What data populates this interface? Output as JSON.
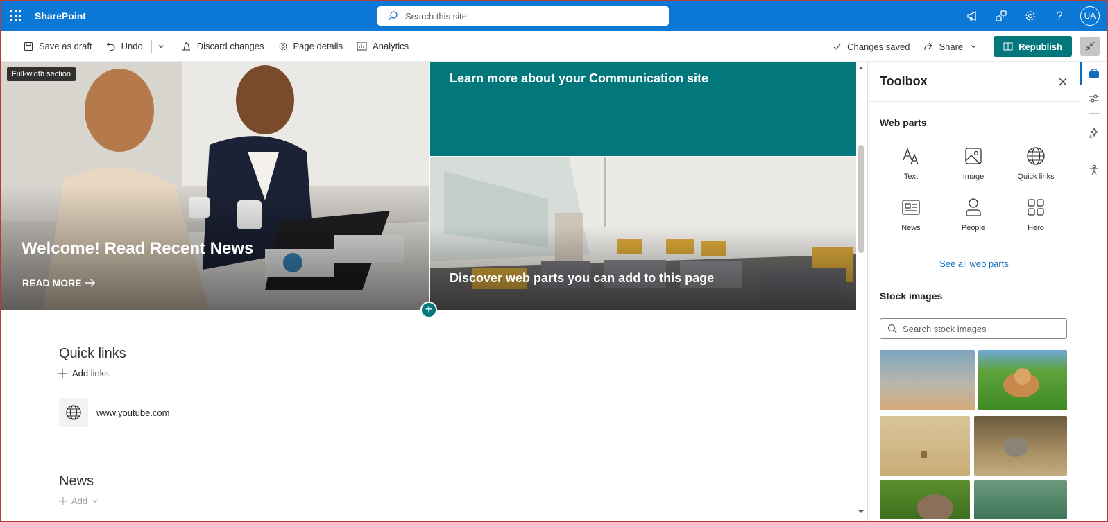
{
  "suite": {
    "app_name": "SharePoint",
    "search_placeholder": "Search this site",
    "avatar_initials": "UA",
    "color": "#0a78d4"
  },
  "commands": {
    "save_draft": "Save as draft",
    "undo": "Undo",
    "discard": "Discard changes",
    "page_details": "Page details",
    "analytics": "Analytics",
    "status": "Changes saved",
    "share": "Share",
    "republish": "Republish"
  },
  "canvas": {
    "tooltip": "Full-width section",
    "hero_main_title": "Welcome! Read Recent News",
    "hero_read_more": "READ MORE",
    "hero_tile1_title": "Learn more about your Communication site",
    "hero_tile2_title": "Discover web parts you can add to this page",
    "quick_links_title": "Quick links",
    "add_links": "Add links",
    "link_url": "www.youtube.com",
    "news_title": "News",
    "news_add": "Add",
    "accent": "#03787c"
  },
  "toolbox": {
    "title": "Toolbox",
    "web_parts_heading": "Web parts",
    "web_parts": [
      {
        "label": "Text",
        "icon": "text-icon"
      },
      {
        "label": "Image",
        "icon": "image-icon"
      },
      {
        "label": "Quick links",
        "icon": "globe-icon"
      },
      {
        "label": "News",
        "icon": "news-icon"
      },
      {
        "label": "People",
        "icon": "person-icon"
      },
      {
        "label": "Hero",
        "icon": "hero-icon"
      }
    ],
    "see_all": "See all web parts",
    "stock_heading": "Stock images",
    "stock_search_placeholder": "Search stock images"
  }
}
